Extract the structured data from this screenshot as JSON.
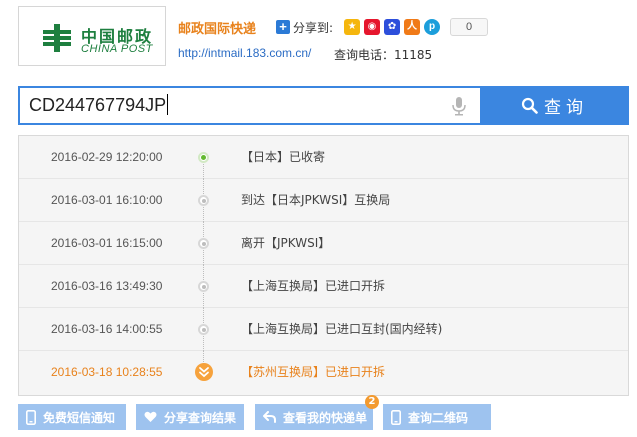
{
  "header": {
    "logo_cn": "中国邮政",
    "logo_en": "CHINA POST",
    "brand_title": "邮政国际快递",
    "share_label": "分享到:",
    "share_count": "0",
    "share_icons": [
      "qzone-icon",
      "weibo-icon",
      "baidu-icon",
      "renren-icon",
      "kaixin-icon"
    ],
    "site_link": "http://intmail.183.com.cn/",
    "hotline": "查询电话：11185"
  },
  "search": {
    "query": "CD244767794JP",
    "button_label": "查询"
  },
  "tracking": [
    {
      "time": "2016-02-29 12:20:00",
      "desc": "【日本】已收寄",
      "status": "first"
    },
    {
      "time": "2016-03-01 16:10:00",
      "desc": "到达【日本JPKWSI】互换局",
      "status": "normal"
    },
    {
      "time": "2016-03-01 16:15:00",
      "desc": "离开【JPKWSI】",
      "status": "normal"
    },
    {
      "time": "2016-03-16 13:49:30",
      "desc": "【上海互换局】已进口开拆",
      "status": "normal"
    },
    {
      "time": "2016-03-16 14:00:55",
      "desc": "【上海互换局】已进口互封(国内经转)",
      "status": "normal"
    },
    {
      "time": "2016-03-18 10:28:55",
      "desc": "【苏州互换局】已进口开拆",
      "status": "latest"
    }
  ],
  "actions": {
    "sms": "免费短信通知",
    "share": "分享查询结果",
    "my_orders": "查看我的快递单",
    "my_orders_badge": "2",
    "qrcode": "查询二维码"
  },
  "colors": {
    "accent_blue": "#3b86e0",
    "brand_orange": "#e8821c",
    "post_green": "#1e7f3f",
    "button_light_blue": "#9ec3ef"
  }
}
